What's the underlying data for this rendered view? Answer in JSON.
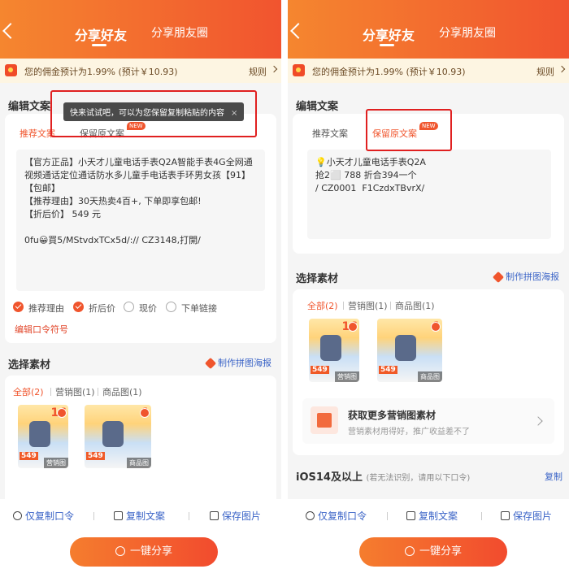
{
  "left": {
    "header": {
      "tab_share_friends": "分享好友",
      "tab_share_moments": "分享朋友圈"
    },
    "commission": {
      "text": "您的佣金预计为1.99% (预计￥10.93)",
      "rule": "规则"
    },
    "edit": {
      "title": "编辑文案",
      "tooltip": "快来试试吧，可以为您保留复制粘贴的内容",
      "tooltip_close": "×",
      "tab_recommend": "推荐文案",
      "tab_keep": "保留原文案",
      "new_badge": "NEW",
      "content": "【官方正品】小天才儿童电话手表Q2A智能手表4G全网通视频通话定位通话防水多儿童手电话表手环男女孩【91】【包邮】\n【推荐理由】30天热卖4百+, 下单即享包邮!\n【折后价】 549 元\n\n0fu😀買5/MStvdxTCx5d/:// CZ3148,打開/",
      "options": [
        {
          "label": "推荐理由",
          "checked": true
        },
        {
          "label": "折后价",
          "checked": true
        },
        {
          "label": "现价",
          "checked": false
        },
        {
          "label": "下单链接",
          "checked": false
        }
      ],
      "edit_code_link": "编辑口令符号"
    },
    "material": {
      "title": "选择素材",
      "poster_link": "制作拼图海报",
      "filters": [
        "全部(2)",
        "营销图(1)",
        "商品图(1)"
      ],
      "thumbs": [
        {
          "price": "549",
          "big": "16",
          "tag": "营销图"
        },
        {
          "price": "549",
          "big": "1",
          "tag": "商品图"
        }
      ]
    },
    "bottom": {
      "copy_code": "仅复制口令",
      "copy_text": "复制文案",
      "save_image": "保存图片",
      "share": "一键分享"
    }
  },
  "right": {
    "header": {
      "tab_share_friends": "分享好友",
      "tab_share_moments": "分享朋友圈"
    },
    "commission": {
      "text": "您的佣金预计为1.99% (预计￥10.93)",
      "rule": "规则"
    },
    "edit": {
      "title": "编辑文案",
      "tab_recommend": "推荐文案",
      "tab_keep": "保留原文案",
      "new_badge": "NEW",
      "content": "💡小天才儿童电话手表Q2A\n抢2⬜ 788 折合394一个\n/ CZ0001  F1CzdxTBvrX/"
    },
    "material": {
      "title": "选择素材",
      "poster_link": "制作拼图海报",
      "filters": [
        "全部(2)",
        "营销图(1)",
        "商品图(1)"
      ],
      "thumbs": [
        {
          "price": "549",
          "big": "16",
          "tag": "营销图"
        },
        {
          "price": "549",
          "big": "1",
          "tag": "商品图"
        }
      ],
      "more_title": "获取更多营销图素材",
      "more_sub": "营销素材用得好，推广收益差不了"
    },
    "ios": {
      "title": "iOS14及以上",
      "hint": "(若无法识别，请用以下口令)",
      "copy": "复制"
    },
    "bottom": {
      "copy_code": "仅复制口令",
      "copy_text": "复制文案",
      "save_image": "保存图片",
      "share": "一键分享"
    }
  }
}
